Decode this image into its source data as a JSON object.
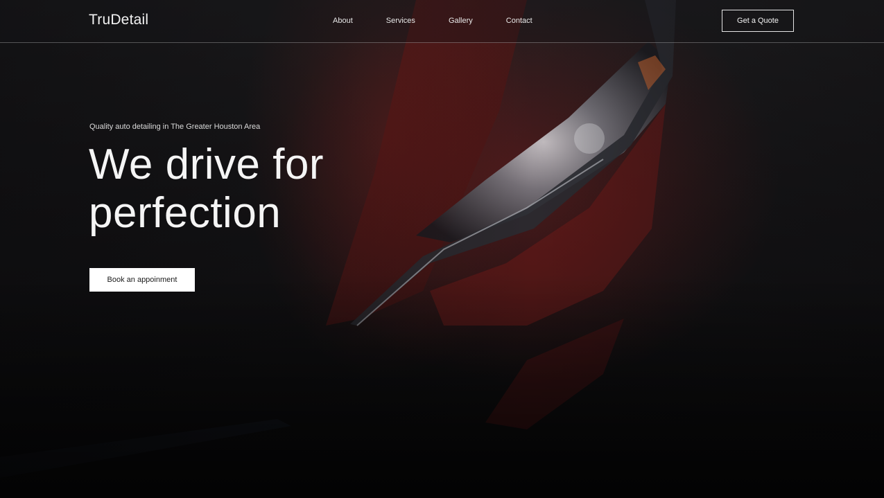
{
  "brand": {
    "logo_text": "TruDetail"
  },
  "nav": {
    "links": [
      {
        "label": "About"
      },
      {
        "label": "Services"
      },
      {
        "label": "Gallery"
      },
      {
        "label": "Contact"
      }
    ],
    "cta_label": "Get a Quote"
  },
  "hero": {
    "tagline": "Quality auto detailing in The Greater Houston Area",
    "headline_line1": "We drive for",
    "headline_line2": "perfection",
    "button_label": "Book an appoinment",
    "background_image": "red-car-headlight-closeup"
  },
  "colors": {
    "background": "#0b0b0c",
    "accent_red": "#8a1f1f",
    "text": "#ffffff",
    "button_bg": "#ffffff",
    "button_text": "#1a1a1a"
  }
}
